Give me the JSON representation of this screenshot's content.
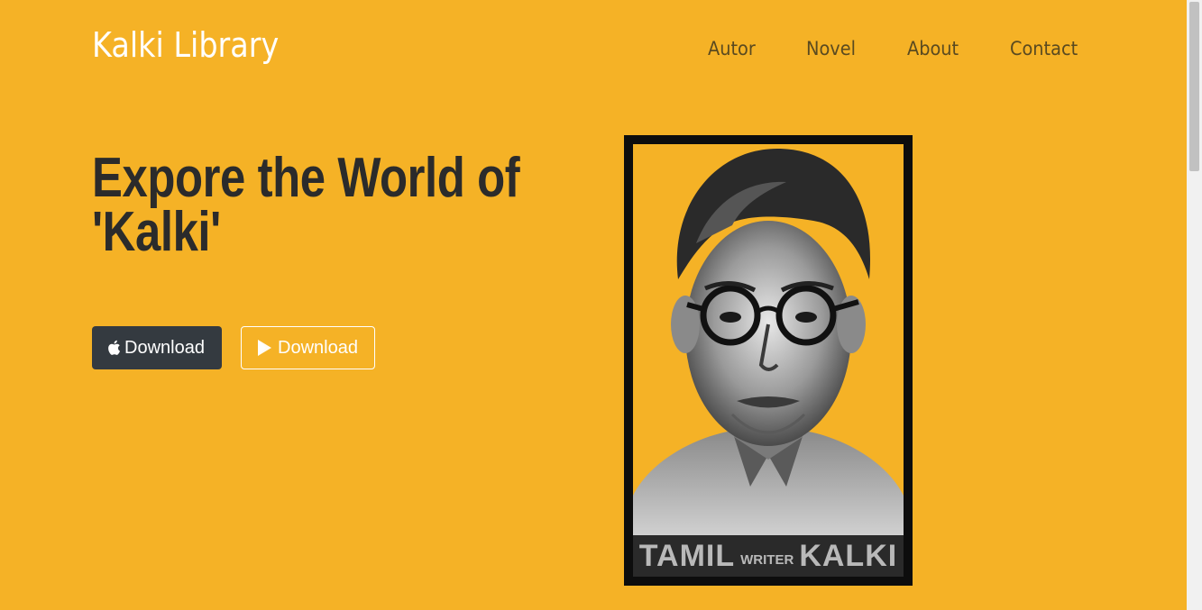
{
  "header": {
    "brand": "Kalki Library",
    "nav": [
      "Autor",
      "Novel",
      "About",
      "Contact"
    ]
  },
  "hero": {
    "title_line1": "Expore the World of",
    "title_line2": "'Kalki'",
    "buttons": {
      "apple": {
        "label": "Download",
        "icon": "apple-icon"
      },
      "play": {
        "label": "Download",
        "icon": "play-store-icon"
      }
    }
  },
  "portrait": {
    "caption_left": "TAMIL",
    "caption_mid": "WRITER",
    "caption_right": "KALKI"
  },
  "colors": {
    "background": "#f5b226",
    "dark_button": "#343a40",
    "headline": "#2b2b2b",
    "nav": "#5a4a20"
  }
}
